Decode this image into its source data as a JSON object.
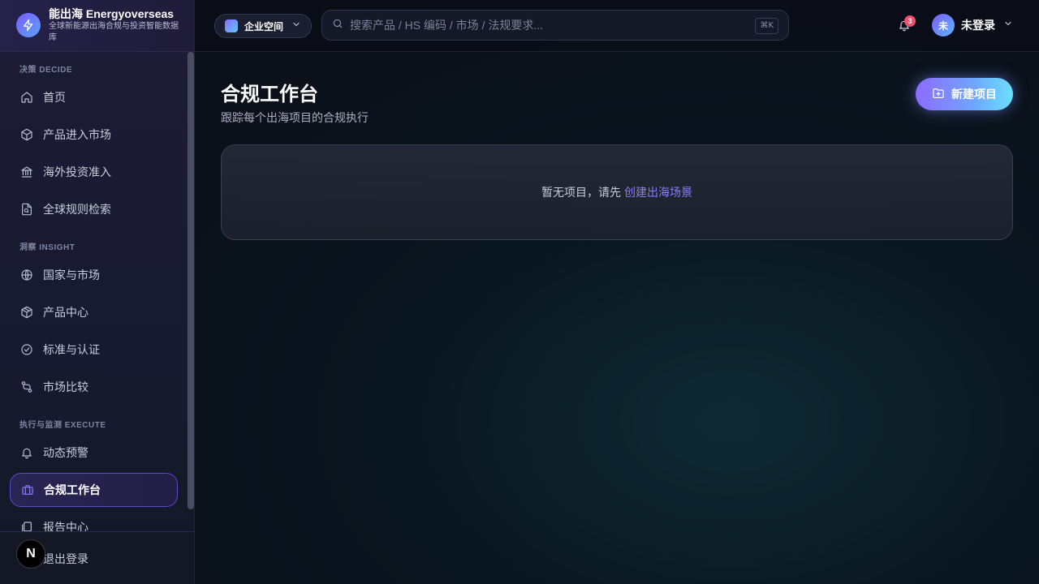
{
  "brand": {
    "title": "能出海 Energyoverseas",
    "subtitle": "全球新能源出海合规与投资智能数据库"
  },
  "sidebar": {
    "sections": [
      {
        "label": "决策 DECIDE",
        "items": [
          {
            "label": "首页",
            "icon": "home-icon"
          },
          {
            "label": "产品进入市场",
            "icon": "box-icon"
          },
          {
            "label": "海外投资准入",
            "icon": "bank-icon"
          },
          {
            "label": "全球规则检索",
            "icon": "file-search-icon"
          }
        ]
      },
      {
        "label": "洞察 INSIGHT",
        "items": [
          {
            "label": "国家与市场",
            "icon": "globe-icon"
          },
          {
            "label": "产品中心",
            "icon": "package-icon"
          },
          {
            "label": "标准与认证",
            "icon": "check-circle-icon"
          },
          {
            "label": "市场比较",
            "icon": "compare-icon"
          }
        ]
      },
      {
        "label": "执行与监测 EXECUTE",
        "items": [
          {
            "label": "动态预警",
            "icon": "bell-icon"
          },
          {
            "label": "合规工作台",
            "icon": "briefcase-icon",
            "active": true
          },
          {
            "label": "报告中心",
            "icon": "copy-icon"
          }
        ]
      }
    ],
    "footer": {
      "logout_label": "退出登录"
    },
    "next_badge": "N"
  },
  "topbar": {
    "workspace_label": "企业空间",
    "search_placeholder": "搜索产品 / HS 编码 / 市场 / 法规要求...",
    "search_shortcut": "⌘K",
    "notification_count": "3",
    "user_avatar_text": "未",
    "user_name": "未登录"
  },
  "main": {
    "title": "合规工作台",
    "subtitle": "跟踪每个出海项目的合规执行",
    "new_button_label": "新建项目",
    "empty_text": "暂无项目，请先",
    "empty_link": "创建出海场景"
  },
  "colors": {
    "accent": "#8b7bff",
    "badge": "#f0506e"
  }
}
